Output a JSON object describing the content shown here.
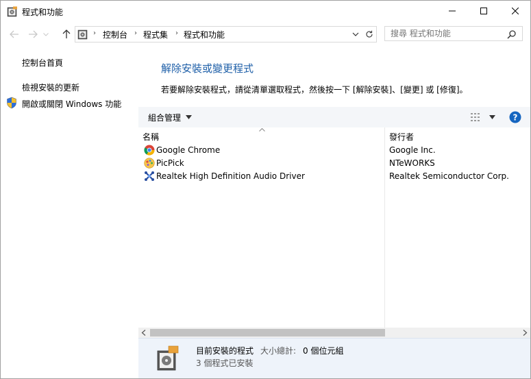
{
  "window": {
    "title": "程式和功能"
  },
  "navigation": {
    "breadcrumbs": [
      "控制台",
      "程式集",
      "程式和功能"
    ],
    "search_placeholder": "搜尋 程式和功能"
  },
  "left_pane": {
    "links": [
      "控制台首頁",
      "檢視安裝的更新",
      "開啟或關閉 Windows 功能"
    ]
  },
  "main": {
    "title": "解除安裝或變更程式",
    "description": "若要解除安裝程式，請從清單選取程式，然後按一下 [解除安裝]、[變更] 或 [修復]。"
  },
  "toolbar": {
    "organize_label": "組合管理"
  },
  "list": {
    "columns": [
      "名稱",
      "發行者"
    ],
    "rows": [
      {
        "name": "Google Chrome",
        "publisher": "Google Inc.",
        "icon": "chrome-icon"
      },
      {
        "name": "PicPick",
        "publisher": "NTeWORKS",
        "icon": "picpick-icon"
      },
      {
        "name": "Realtek High Definition Audio Driver",
        "publisher": "Realtek Semiconductor Corp.",
        "icon": "realtek-icon"
      }
    ]
  },
  "details": {
    "title": "目前安裝的程式",
    "size_label": "大小總計:",
    "size_value": "0 個位元組",
    "count_text": "3 個程式已安裝"
  },
  "colors": {
    "title_blue": "#1e5fa8",
    "toolbar_bg": "#f4f6f9",
    "details_bg": "#eef3fa",
    "help_blue": "#1565c0"
  }
}
